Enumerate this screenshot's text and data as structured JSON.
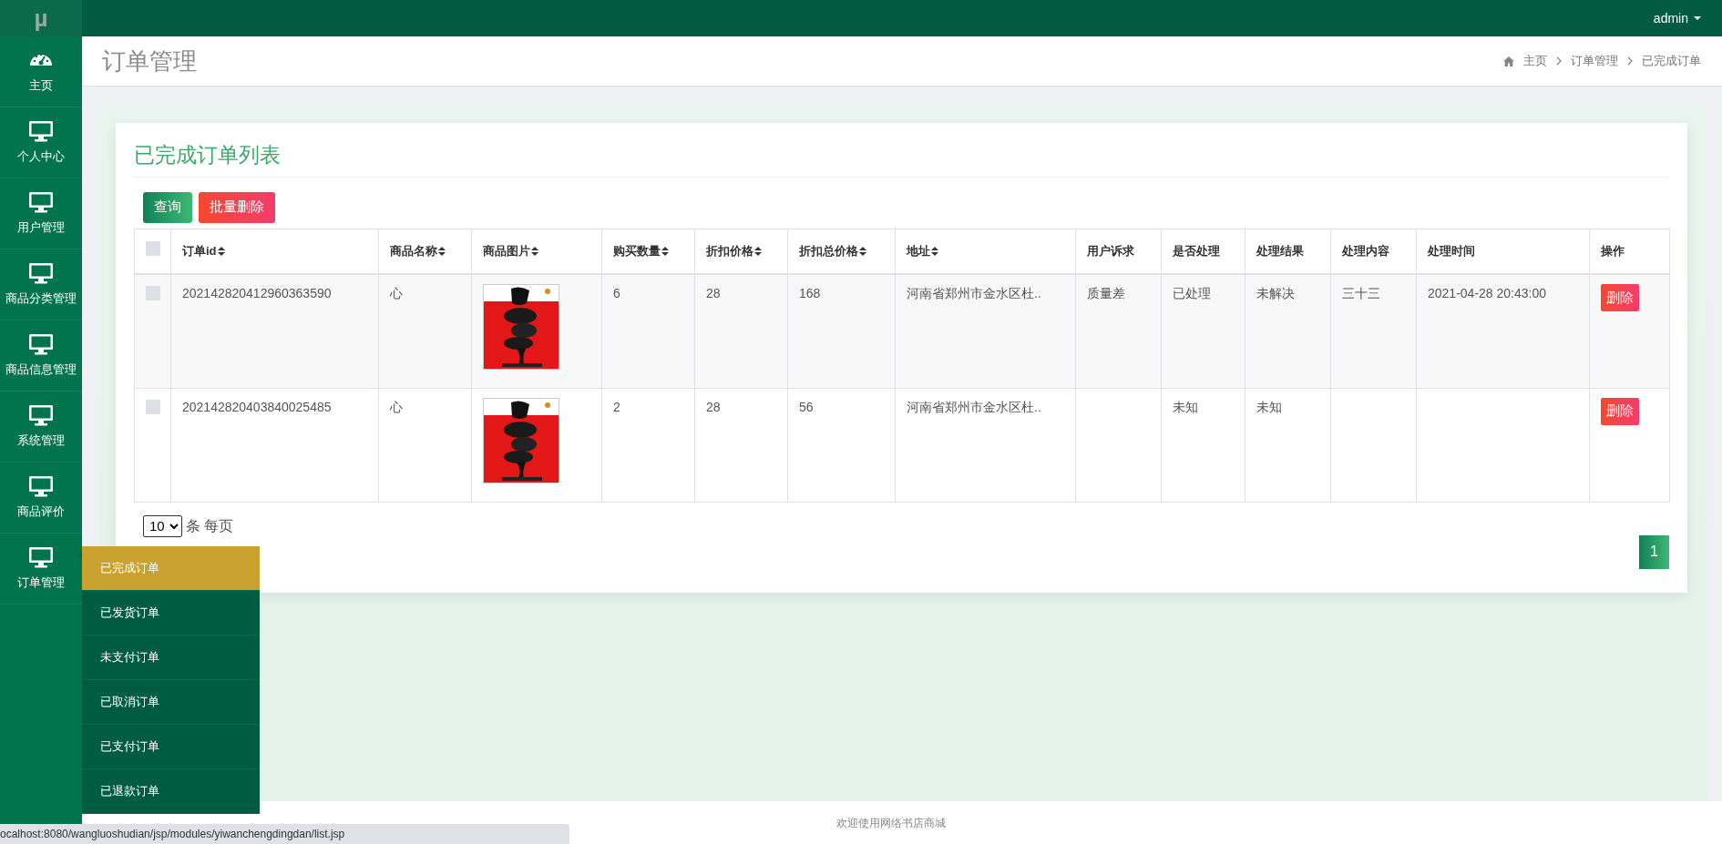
{
  "brand": {
    "logo": "µ"
  },
  "user_menu": {
    "label": "admin"
  },
  "sidebar": {
    "items": [
      {
        "label": "主页",
        "kind": "dashboard",
        "expanded": false
      },
      {
        "label": "个人中心",
        "kind": "module",
        "expanded": false
      },
      {
        "label": "用户管理",
        "kind": "module",
        "expanded": false
      },
      {
        "label": "商品分类管理",
        "kind": "module",
        "expanded": false
      },
      {
        "label": "商品信息管理",
        "kind": "module",
        "expanded": false
      },
      {
        "label": "系统管理",
        "kind": "module",
        "expanded": false
      },
      {
        "label": "商品评价",
        "kind": "module",
        "expanded": false
      },
      {
        "label": "订单管理",
        "kind": "module",
        "expanded": true
      }
    ]
  },
  "submenu": {
    "items": [
      {
        "label": "已完成订单",
        "selected": true
      },
      {
        "label": "已发货订单",
        "selected": false
      },
      {
        "label": "未支付订单",
        "selected": false
      },
      {
        "label": "已取消订单",
        "selected": false
      },
      {
        "label": "已支付订单",
        "selected": false
      },
      {
        "label": "已退款订单",
        "selected": false
      }
    ]
  },
  "page_title": "订单管理",
  "breadcrumb": [
    "主页",
    "订单管理",
    "已完成订单"
  ],
  "card": {
    "title": "已完成订单列表",
    "buttons": [
      {
        "label": "查询",
        "kind": "primary"
      },
      {
        "label": "批量删除",
        "kind": "danger"
      }
    ],
    "table": {
      "header_checkbox": {
        "checked": false
      },
      "columns": [
        {
          "label": "订单id",
          "sortable": true
        },
        {
          "label": "商品名称",
          "sortable": true
        },
        {
          "label": "商品图片",
          "sortable": true
        },
        {
          "label": "购买数量",
          "sortable": true
        },
        {
          "label": "折扣价格",
          "sortable": true
        },
        {
          "label": "折扣总价格",
          "sortable": true
        },
        {
          "label": "地址",
          "sortable": true
        },
        {
          "label": "用户诉求",
          "sortable": false
        },
        {
          "label": "是否处理",
          "sortable": false
        },
        {
          "label": "处理结果",
          "sortable": false
        },
        {
          "label": "处理内容",
          "sortable": false
        },
        {
          "label": "处理时间",
          "sortable": false
        },
        {
          "label": "操作",
          "sortable": false
        }
      ],
      "rows": [
        {
          "checked": false,
          "cells": [
            {
              "kind": "text",
              "text": "202142820412960363590"
            },
            {
              "kind": "text",
              "text": "心"
            },
            {
              "kind": "picture"
            },
            {
              "kind": "text",
              "text": "6"
            },
            {
              "kind": "text",
              "text": "28"
            },
            {
              "kind": "text",
              "text": "168"
            },
            {
              "kind": "text",
              "text": "河南省郑州市金水区杜.."
            },
            {
              "kind": "text",
              "text": "质量差"
            },
            {
              "kind": "text",
              "text": "已处理"
            },
            {
              "kind": "text",
              "text": "未解决"
            },
            {
              "kind": "text",
              "text": "三十三"
            },
            {
              "kind": "text",
              "text": "2021-04-28 20:43:00"
            },
            {
              "kind": "button",
              "text": "删除"
            }
          ]
        },
        {
          "checked": false,
          "cells": [
            {
              "kind": "text",
              "text": "202142820403840025485"
            },
            {
              "kind": "text",
              "text": "心"
            },
            {
              "kind": "picture"
            },
            {
              "kind": "text",
              "text": "2"
            },
            {
              "kind": "text",
              "text": "28"
            },
            {
              "kind": "text",
              "text": "56"
            },
            {
              "kind": "text",
              "text": "河南省郑州市金水区杜.."
            },
            {
              "kind": "empty"
            },
            {
              "kind": "text",
              "text": "未知"
            },
            {
              "kind": "text",
              "text": "未知"
            },
            {
              "kind": "empty"
            },
            {
              "kind": "empty"
            },
            {
              "kind": "button",
              "text": "删除"
            }
          ]
        }
      ]
    },
    "page_size": {
      "value": "10",
      "label": "条 每页"
    },
    "pagination": [
      {
        "label": "1",
        "selected": true
      }
    ]
  },
  "footer": "欢迎使用网络书店商城",
  "status_url": "ocalhost:8080/wangluoshudian/jsp/modules/yiwanchengdingdan/list.jsp"
}
